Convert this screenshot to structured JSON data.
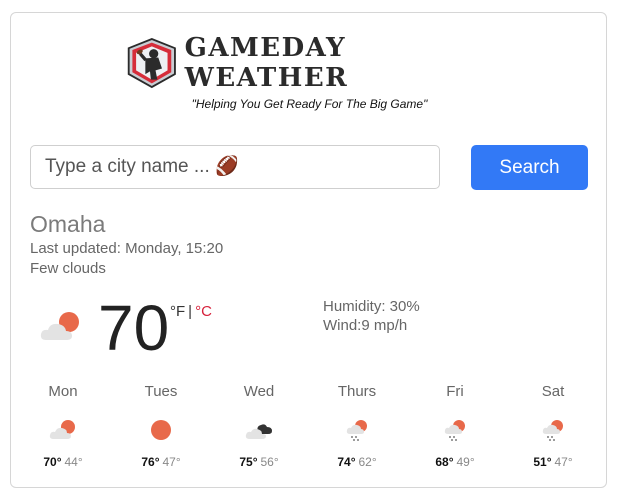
{
  "header": {
    "app_title": "GAMEDAY WEATHER",
    "tagline": "\"Helping You Get Ready For The Big Game\""
  },
  "search": {
    "placeholder": "Type a city name ... 🏈",
    "value": "",
    "button_label": "Search"
  },
  "current": {
    "city": "Omaha",
    "last_updated": "Last updated: Monday, 15:20",
    "description": "Few clouds",
    "temperature": "70",
    "unit_f": "°F",
    "unit_separator": "|",
    "unit_c": "°C",
    "humidity": "Humidity: 30%",
    "wind": "Wind:9 mp/h",
    "icon": "few-clouds-icon"
  },
  "forecast": [
    {
      "day": "Mon",
      "high": "70°",
      "low": "44°",
      "icon": "few-clouds-icon"
    },
    {
      "day": "Tues",
      "high": "76°",
      "low": "47°",
      "icon": "sun-icon"
    },
    {
      "day": "Wed",
      "high": "75°",
      "low": "56°",
      "icon": "broken-clouds-icon"
    },
    {
      "day": "Thurs",
      "high": "74°",
      "low": "62°",
      "icon": "rain-sun-icon"
    },
    {
      "day": "Fri",
      "high": "68°",
      "low": "49°",
      "icon": "rain-sun-icon"
    },
    {
      "day": "Sat",
      "high": "51°",
      "low": "47°",
      "icon": "rain-sun-icon"
    }
  ],
  "colors": {
    "accent": "#3279f6",
    "celsius_link": "#d6213b",
    "sun": "#e8694a",
    "cloud": "#e3e3e3"
  }
}
